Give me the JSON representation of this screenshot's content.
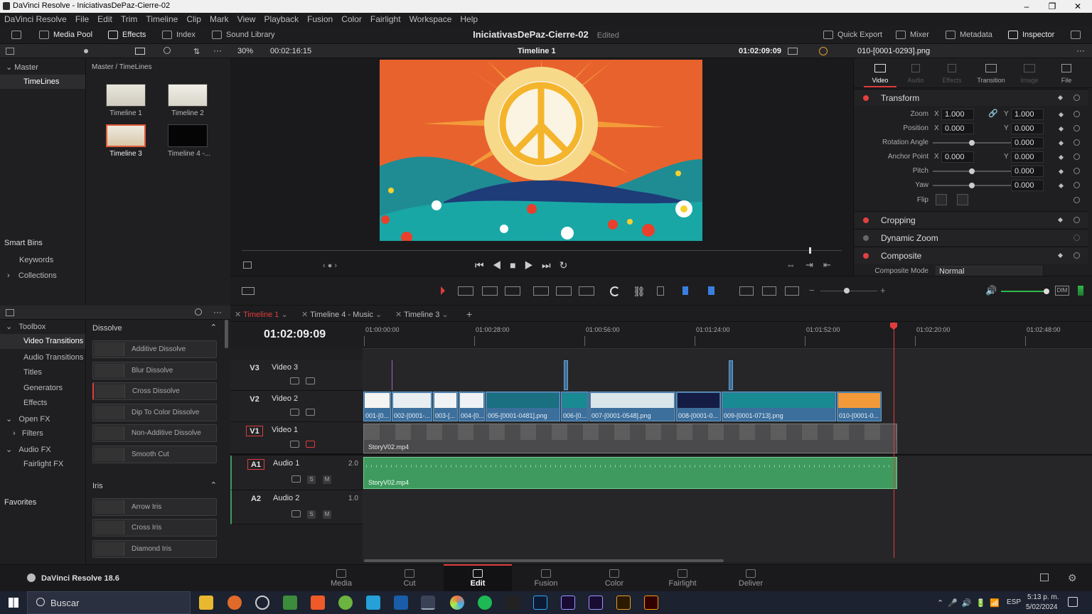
{
  "window": {
    "title": "DaVinci Resolve - IniciativasDePaz-Cierre-02",
    "min": "–",
    "max": "❐",
    "close": "✕"
  },
  "menu": [
    "DaVinci Resolve",
    "File",
    "Edit",
    "Trim",
    "Timeline",
    "Clip",
    "Mark",
    "View",
    "Playback",
    "Fusion",
    "Color",
    "Fairlight",
    "Workspace",
    "Help"
  ],
  "toolbar": {
    "media_pool": "Media Pool",
    "effects": "Effects",
    "index": "Index",
    "sound_library": "Sound Library",
    "project_name": "IniciativasDePaz-Cierre-02",
    "project_status": "Edited",
    "quick_export": "Quick Export",
    "mixer": "Mixer",
    "metadata": "Metadata",
    "inspector": "Inspector"
  },
  "media_pool": {
    "zoom": "30%",
    "duration": "00:02:16:15",
    "master": "Master",
    "timelines_bin": "TimeLines",
    "breadcrumb": "Master / TimeLines",
    "smart_bins": "Smart Bins",
    "keywords": "Keywords",
    "collections": "Collections",
    "items": [
      "Timeline 1",
      "Timeline 2",
      "Timeline 3",
      "Timeline 4 -..."
    ]
  },
  "viewer": {
    "timeline_name": "Timeline 1",
    "timecode": "01:02:09:09"
  },
  "effects": {
    "toolbox": "Toolbox",
    "tree": [
      "Video Transitions",
      "Audio Transitions",
      "Titles",
      "Generators",
      "Effects"
    ],
    "open_fx": "Open FX",
    "filters": "Filters",
    "audio_fx": "Audio FX",
    "fairlight_fx": "Fairlight FX",
    "favorites": "Favorites",
    "dissolve_header": "Dissolve",
    "dissolve": [
      "Additive Dissolve",
      "Blur Dissolve",
      "Cross Dissolve",
      "Dip To Color Dissolve",
      "Non-Additive Dissolve",
      "Smooth Cut"
    ],
    "iris_header": "Iris",
    "iris": [
      "Arrow Iris",
      "Cross Iris",
      "Diamond Iris"
    ]
  },
  "inspector": {
    "clip_name": "010-[0001-0293].png",
    "tabs": [
      "Video",
      "Audio",
      "Effects",
      "Transition",
      "Image",
      "File"
    ],
    "transform": "Transform",
    "zoom": "Zoom",
    "position": "Position",
    "rotation": "Rotation Angle",
    "anchor": "Anchor Point",
    "pitch": "Pitch",
    "yaw": "Yaw",
    "flip": "Flip",
    "x": "X",
    "y": "Y",
    "zoom_x": "1.000",
    "zoom_y": "1.000",
    "pos_x": "0.000",
    "pos_y": "0.000",
    "rot": "0.000",
    "anc_x": "0.000",
    "anc_y": "0.000",
    "pitch_v": "0.000",
    "yaw_v": "0.000",
    "cropping": "Cropping",
    "dynamic_zoom": "Dynamic Zoom",
    "composite": "Composite",
    "composite_mode": "Composite Mode",
    "composite_mode_value": "Normal"
  },
  "timeline": {
    "tabs": [
      "Timeline 1",
      "Timeline 4 - Music",
      "Timeline 3"
    ],
    "timecode": "01:02:09:09",
    "ruler": [
      "01:00:00:00",
      "01:00:28:00",
      "01:00:56:00",
      "01:01:24:00",
      "01:01:52:00",
      "01:02:20:00",
      "01:02:48:00"
    ],
    "playhead_fraction": 0.728,
    "tracks": [
      {
        "id": "V3",
        "name": "Video 3"
      },
      {
        "id": "V2",
        "name": "Video 2"
      },
      {
        "id": "V1",
        "name": "Video 1"
      },
      {
        "id": "A1",
        "name": "Audio 1",
        "level": "2.0"
      },
      {
        "id": "A2",
        "name": "Audio 2",
        "level": "1.0"
      }
    ],
    "v2_clips": [
      "001-[0...",
      "002-[0001-...",
      "003-[...",
      "004-[0...",
      "005-[0001-0481].png",
      "006-[0...",
      "007-[0001-0548].png",
      "008-[0001-0...",
      "009-[0001-0713].png",
      "010-[0001-0..."
    ],
    "v1_clip": "StoryV02.mp4",
    "a1_clip": "StoryV02.mp4",
    "solo": "S",
    "mute": "M"
  },
  "pages": [
    "Media",
    "Cut",
    "Edit",
    "Fusion",
    "Color",
    "Fairlight",
    "Deliver"
  ],
  "app_version": "DaVinci Resolve 18.6",
  "taskbar": {
    "search": "Buscar",
    "lang": "ESP",
    "time": "5:13 p. m.",
    "date": "5/02/2024"
  },
  "colors": {
    "accent": "#e03c3c",
    "clip_video": "#3c6f9c",
    "clip_audio": "#3e9a5f",
    "bg": "#1f1f21"
  }
}
